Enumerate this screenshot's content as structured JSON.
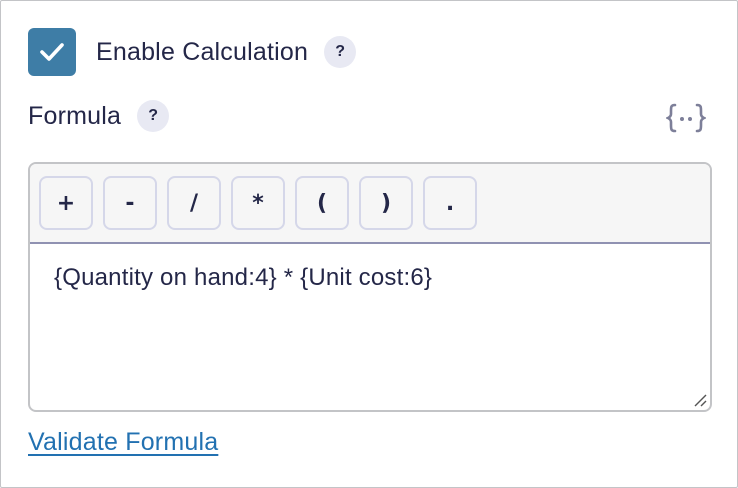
{
  "calculation": {
    "enabled": true,
    "label": "Enable Calculation",
    "help_icon": "?"
  },
  "formula": {
    "label": "Formula",
    "help_icon": "?",
    "merge_tag_icon": "{..}",
    "operators": [
      "+",
      "-",
      "/",
      "*",
      "(",
      ")",
      "."
    ],
    "value": "{Quantity on hand:4} * {Unit cost:6}"
  },
  "validate_link": "Validate Formula",
  "colors": {
    "checkbox": "#3e7da6",
    "link": "#2271b1",
    "text": "#242748",
    "help_bg": "#e8e9f3"
  }
}
